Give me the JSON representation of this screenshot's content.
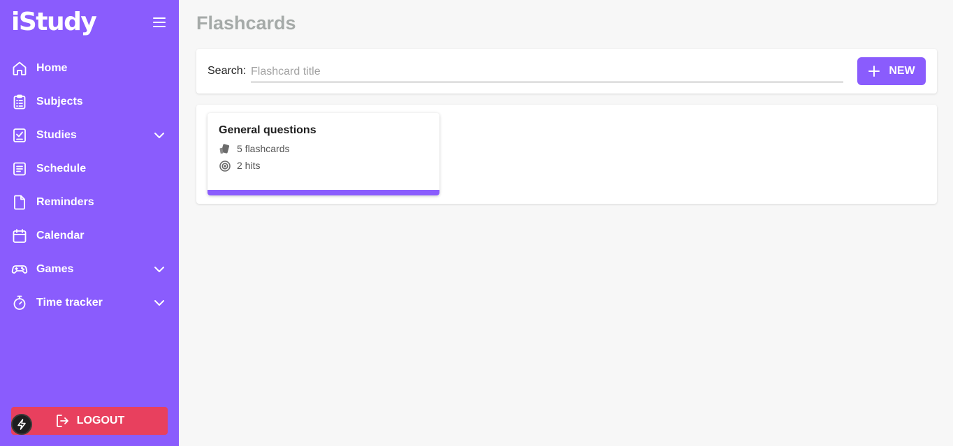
{
  "app": {
    "name": "iStudy"
  },
  "sidebar": {
    "items": [
      {
        "label": "Home",
        "icon": "home-icon",
        "expandable": false
      },
      {
        "label": "Subjects",
        "icon": "clipboard-icon",
        "expandable": false
      },
      {
        "label": "Studies",
        "icon": "checkbox-icon",
        "expandable": true
      },
      {
        "label": "Schedule",
        "icon": "schedule-icon",
        "expandable": false
      },
      {
        "label": "Reminders",
        "icon": "document-icon",
        "expandable": false
      },
      {
        "label": "Calendar",
        "icon": "calendar-icon",
        "expandable": false
      },
      {
        "label": "Games",
        "icon": "gamepad-icon",
        "expandable": true
      },
      {
        "label": "Time tracker",
        "icon": "stopwatch-icon",
        "expandable": true
      }
    ],
    "logout_label": "LOGOUT"
  },
  "page": {
    "title": "Flashcards"
  },
  "search": {
    "label": "Search:",
    "placeholder": "Flashcard title",
    "value": ""
  },
  "toolbar": {
    "new_label": "NEW"
  },
  "decks": [
    {
      "title": "General questions",
      "count_text": "5 flashcards",
      "hits_text": "2 hits",
      "progress": 1.0
    }
  ],
  "colors": {
    "accent": "#8a5cfd",
    "logout": "#e8405e",
    "background": "#f7f7f7",
    "title": "#a5aaa8"
  }
}
